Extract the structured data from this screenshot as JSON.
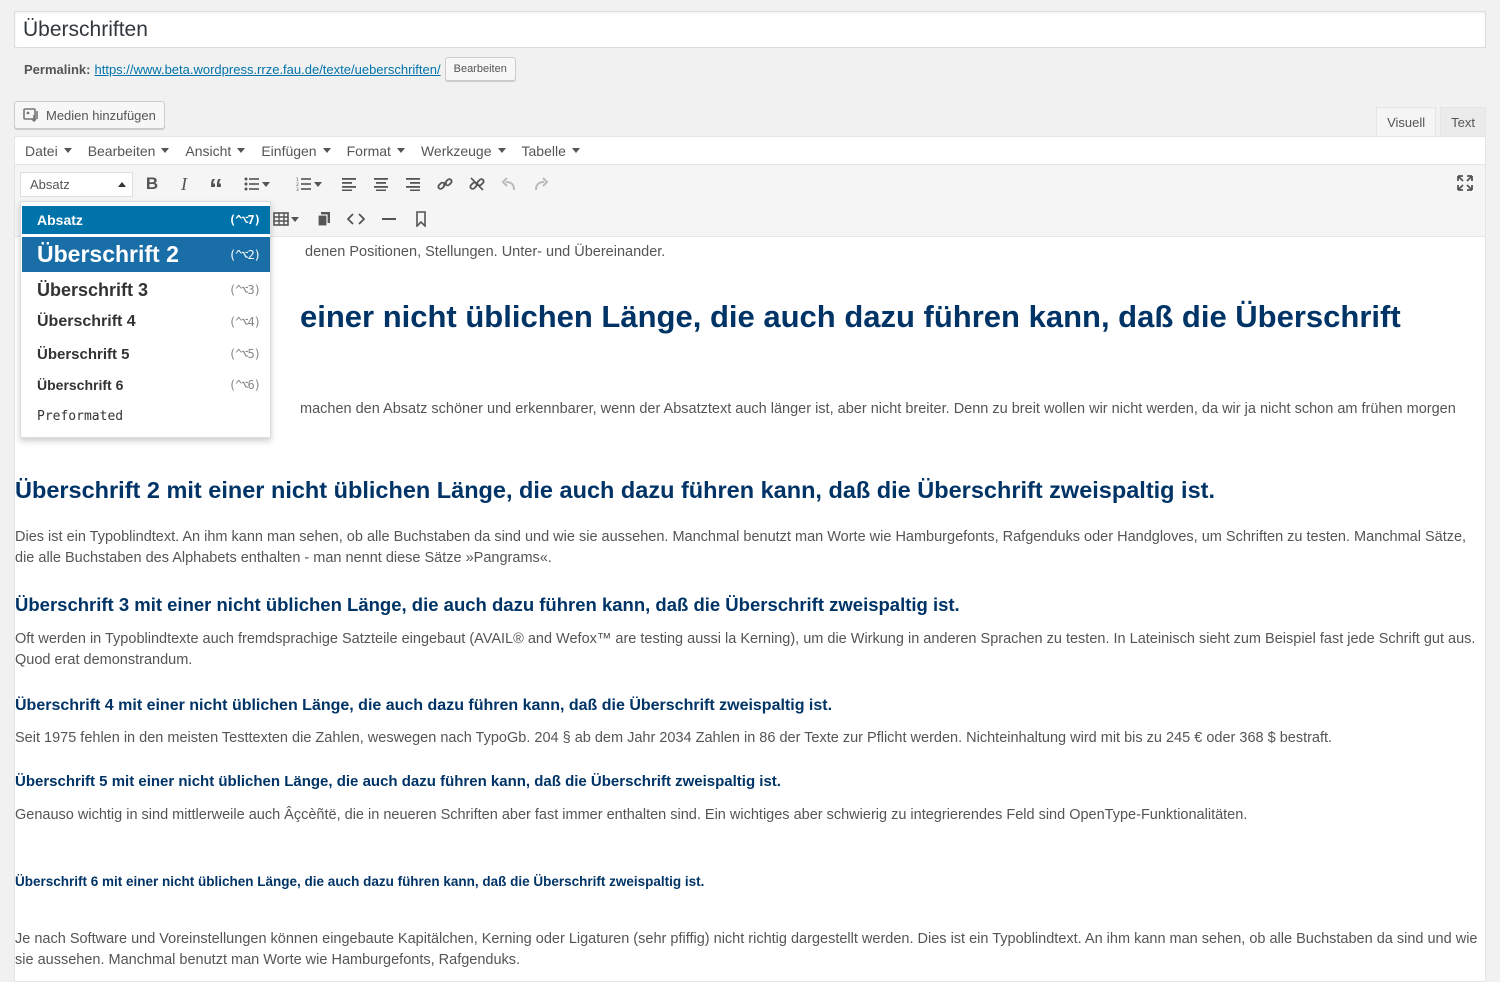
{
  "post": {
    "title": "Überschriften",
    "permalink_label": "Permalink:",
    "permalink_url": "https://www.beta.wordpress.rrze.fau.de/texte/ueberschriften/",
    "edit_button": "Bearbeiten"
  },
  "media_button": "Medien hinzufügen",
  "tabs": {
    "visual": "Visuell",
    "text": "Text"
  },
  "menubar": [
    "Datei",
    "Bearbeiten",
    "Ansicht",
    "Einfügen",
    "Format",
    "Werkzeuge",
    "Tabelle"
  ],
  "format_select": {
    "value": "Absatz"
  },
  "format_dropdown": [
    {
      "label": "Absatz",
      "shortcut": "(^⌥7)"
    },
    {
      "label": "Überschrift 2",
      "shortcut": "(^⌥2)"
    },
    {
      "label": "Überschrift 3",
      "shortcut": "(^⌥3)"
    },
    {
      "label": "Überschrift 4",
      "shortcut": "(^⌥4)"
    },
    {
      "label": "Überschrift 5",
      "shortcut": "(^⌥5)"
    },
    {
      "label": "Überschrift 6",
      "shortcut": "(^⌥6)"
    },
    {
      "label": "Preformated",
      "shortcut": ""
    }
  ],
  "content": {
    "p0_visible": "denen Positionen, Stellungen. Unter- und Übereinander.",
    "h1_visible": "einer nicht üblichen Länge, die auch dazu führen kann, daß die Überschrift",
    "p1_visible": "machen den Absatz schöner und erkennbarer, wenn der Absatztext auch länger ist, aber nicht breiter. Denn zu breit wollen wir nicht werden, da wir ja nicht schon am frühen morgen",
    "h2": "Überschrift 2 mit einer nicht üblichen Länge, die auch dazu führen kann, daß die Überschrift zweispaltig ist.",
    "p2": "Dies ist ein Typoblindtext. An ihm kann man sehen, ob alle Buchstaben da sind und wie sie aussehen. Manchmal benutzt man Worte wie Hamburgefonts, Rafgenduks oder Handgloves, um Schriften zu testen. Manchmal Sätze, die alle Buchstaben des Alphabets enthalten - man nennt diese Sätze »Pangrams«.",
    "h3": "Überschrift 3 mit einer nicht üblichen Länge, die auch dazu führen kann, daß die Überschrift zweispaltig ist.",
    "p3": "Oft werden in Typoblindtexte auch fremdsprachige Satzteile eingebaut (AVAIL® and Wefox™ are testing aussi la Kerning), um die Wirkung in anderen Sprachen zu testen. In Lateinisch sieht zum Beispiel fast jede Schrift gut aus. Quod erat demonstrandum.",
    "h4": "Überschrift 4 mit einer nicht üblichen Länge, die auch dazu führen kann, daß die Überschrift zweispaltig ist.",
    "p4": "Seit 1975 fehlen in den meisten Testtexten die Zahlen, weswegen nach TypoGb. 204 § ab dem Jahr 2034 Zahlen in 86 der Texte zur Pflicht werden. Nichteinhaltung wird mit bis zu 245 € oder 368 $ bestraft.",
    "h5": "Überschrift 5 mit einer nicht üblichen Länge, die auch dazu führen kann, daß die Überschrift zweispaltig ist.",
    "p5": "Genauso wichtig in sind mittlerweile auch Âçcèñtë, die in neueren Schriften aber fast immer enthalten sind. Ein wichtiges aber schwierig zu integrierendes Feld sind OpenType-Funktionalitäten.",
    "h6": "Überschrift 6 mit einer nicht üblichen Länge, die auch dazu führen kann, daß die Überschrift zweispaltig ist.",
    "p6": "Je nach Software und Voreinstellungen können eingebaute Kapitälchen, Kerning oder Ligaturen (sehr pfiffig) nicht richtig dargestellt werden. Dies ist ein Typoblindtext. An ihm kann man sehen, ob alle Buchstaben da sind und wie sie aussehen. Manchmal benutzt man Worte wie Hamburgefonts, Rafgenduks."
  },
  "colors": {
    "heading": "#003366",
    "accent": "#0073aa",
    "highlight": "#1a6ea8"
  }
}
